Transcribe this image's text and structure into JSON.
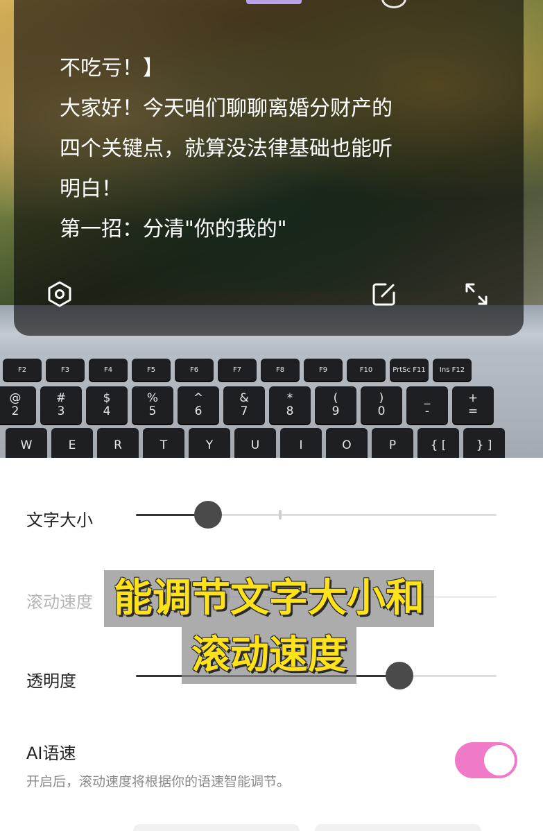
{
  "prompter": {
    "lines": [
      "不吃亏！】",
      "大家好！今天咱们聊聊离婚分财产的",
      "四个关键点，就算没法律基础也能听",
      "明白！",
      "第一招：分清\"你的我的\""
    ]
  },
  "keyboard": {
    "fn_row": [
      "F2",
      "F3",
      "F4",
      "F5",
      "F6",
      "F7",
      "F8",
      "F9",
      "F10",
      "PrtSc F11",
      "Ins F12"
    ],
    "num_row": [
      [
        "@",
        "2"
      ],
      [
        "#",
        "3"
      ],
      [
        "$",
        "4"
      ],
      [
        "%",
        "5"
      ],
      [
        "^",
        "6"
      ],
      [
        "&",
        "7"
      ],
      [
        "*",
        "8"
      ],
      [
        "(",
        "9"
      ],
      [
        ")",
        "0"
      ],
      [
        "_",
        "-"
      ],
      [
        "+",
        "="
      ]
    ],
    "q_row": [
      "W",
      "E",
      "R",
      "T",
      "Y",
      "U",
      "I",
      "O",
      "P",
      "{ [",
      "} ]"
    ]
  },
  "settings": {
    "font_size": {
      "label": "文字大小",
      "value": 0.2
    },
    "scroll_speed": {
      "label": "滚动速度"
    },
    "opacity": {
      "label": "透明度",
      "value": 0.73
    },
    "ai_speed": {
      "label": "AI语速",
      "enabled": true,
      "hint": "开启后，滚动速度将根据你的语速智能调节。"
    }
  },
  "caption": {
    "line1": "能调节文字大小和",
    "line2": "滚动速度"
  },
  "colors": {
    "accent": "#f07ac8",
    "caption_text": "#ffe21a"
  }
}
